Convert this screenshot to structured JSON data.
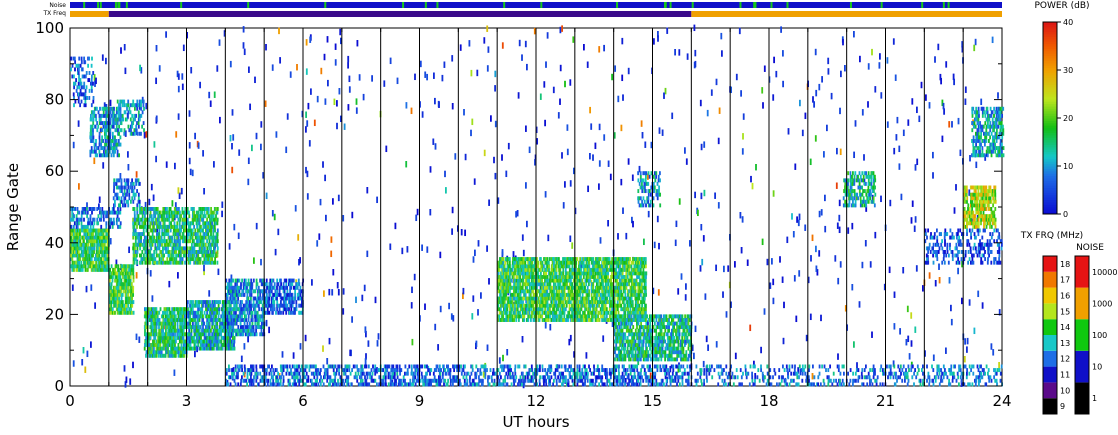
{
  "chart_data": {
    "type": "heatmap",
    "xlabel": "UT hours",
    "ylabel": "Range Gate",
    "x_ticks": [
      "0",
      "3",
      "6",
      "9",
      "12",
      "15",
      "18",
      "21",
      "24"
    ],
    "y_ticks": [
      "0",
      "20",
      "40",
      "60",
      "80",
      "100"
    ],
    "xlim": [
      0,
      24
    ],
    "ylim": [
      0,
      100
    ],
    "grid_vertical_hours": [
      1,
      2,
      3,
      4,
      5,
      6,
      7,
      8,
      9,
      10,
      11,
      12,
      13,
      14,
      15,
      16,
      17,
      18,
      19,
      20,
      21,
      22,
      23
    ],
    "top_bars": {
      "noise_label": "Noise",
      "txfreq_label": "TX Freq",
      "noise_segments": [
        {
          "from": 0,
          "to": 24,
          "color": "#1010c8"
        }
      ],
      "txfreq_segments": [
        {
          "from": 0,
          "to": 1,
          "color": "#f0a000"
        },
        {
          "from": 1,
          "to": 16,
          "color": "#3a0a8a"
        },
        {
          "from": 16,
          "to": 24,
          "color": "#f0a000"
        }
      ]
    },
    "power_colorbar": {
      "title": "POWER (dB)",
      "ticks": [
        "0",
        "10",
        "20",
        "30",
        "40"
      ],
      "range": [
        0,
        40
      ]
    },
    "txfreq_colorbar": {
      "title": "TX FRQ (MHz)",
      "ticks": [
        "9",
        "10",
        "11",
        "12",
        "13",
        "14",
        "15",
        "16",
        "17",
        "18"
      ],
      "colors": [
        "#000000",
        "#5a0a8a",
        "#1010c8",
        "#1e6ee6",
        "#18c8c8",
        "#10c810",
        "#b4e61e",
        "#f0c800",
        "#f07800",
        "#e61414"
      ]
    },
    "noise_colorbar": {
      "title": "NOISE",
      "ticks": [
        "1",
        "10",
        "100",
        "1000",
        "10000"
      ],
      "colors": [
        "#000000",
        "#1010c8",
        "#10c810",
        "#f0a000",
        "#e61414"
      ]
    },
    "regions": [
      {
        "x0": 0.0,
        "x1": 1.0,
        "y0": 32,
        "y1": 44,
        "power": 17,
        "density": 0.9
      },
      {
        "x0": 0.0,
        "x1": 1.3,
        "y0": 44,
        "y1": 50,
        "power": 8,
        "density": 0.5
      },
      {
        "x0": 0.5,
        "x1": 1.3,
        "y0": 64,
        "y1": 78,
        "power": 10,
        "density": 0.6
      },
      {
        "x0": 0.0,
        "x1": 0.6,
        "y0": 78,
        "y1": 92,
        "power": 6,
        "density": 0.3
      },
      {
        "x0": 1.0,
        "x1": 1.6,
        "y0": 20,
        "y1": 34,
        "power": 18,
        "density": 0.85
      },
      {
        "x0": 1.1,
        "x1": 1.8,
        "y0": 50,
        "y1": 58,
        "power": 8,
        "density": 0.5
      },
      {
        "x0": 1.2,
        "x1": 1.9,
        "y0": 70,
        "y1": 80,
        "power": 10,
        "density": 0.5
      },
      {
        "x0": 1.6,
        "x1": 3.8,
        "y0": 34,
        "y1": 50,
        "power": 15,
        "density": 0.75
      },
      {
        "x0": 1.9,
        "x1": 3.0,
        "y0": 8,
        "y1": 22,
        "power": 15,
        "density": 0.85
      },
      {
        "x0": 3.0,
        "x1": 4.2,
        "y0": 10,
        "y1": 24,
        "power": 12,
        "density": 0.8
      },
      {
        "x0": 4.0,
        "x1": 5.0,
        "y0": 14,
        "y1": 30,
        "power": 9,
        "density": 0.75
      },
      {
        "x0": 5.0,
        "x1": 6.0,
        "y0": 20,
        "y1": 30,
        "power": 6,
        "density": 0.6
      },
      {
        "x0": 11.0,
        "x1": 14.8,
        "y0": 18,
        "y1": 36,
        "power": 17,
        "density": 0.85
      },
      {
        "x0": 14.0,
        "x1": 16.0,
        "y0": 7,
        "y1": 20,
        "power": 14,
        "density": 0.75
      },
      {
        "x0": 14.6,
        "x1": 15.2,
        "y0": 50,
        "y1": 60,
        "power": 10,
        "density": 0.5
      },
      {
        "x0": 19.9,
        "x1": 20.7,
        "y0": 50,
        "y1": 60,
        "power": 13,
        "density": 0.6
      },
      {
        "x0": 23.0,
        "x1": 23.8,
        "y0": 44,
        "y1": 56,
        "power": 24,
        "density": 0.75
      },
      {
        "x0": 23.2,
        "x1": 24.0,
        "y0": 64,
        "y1": 78,
        "power": 11,
        "density": 0.6
      },
      {
        "x0": 22.0,
        "x1": 24.0,
        "y0": 34,
        "y1": 44,
        "power": 5,
        "density": 0.35
      },
      {
        "x0": 4.0,
        "x1": 16.0,
        "y0": 0,
        "y1": 6,
        "power": 7,
        "density": 0.5
      },
      {
        "x0": 16.0,
        "x1": 24.0,
        "y0": 0,
        "y1": 6,
        "power": 8,
        "density": 0.3
      }
    ]
  }
}
